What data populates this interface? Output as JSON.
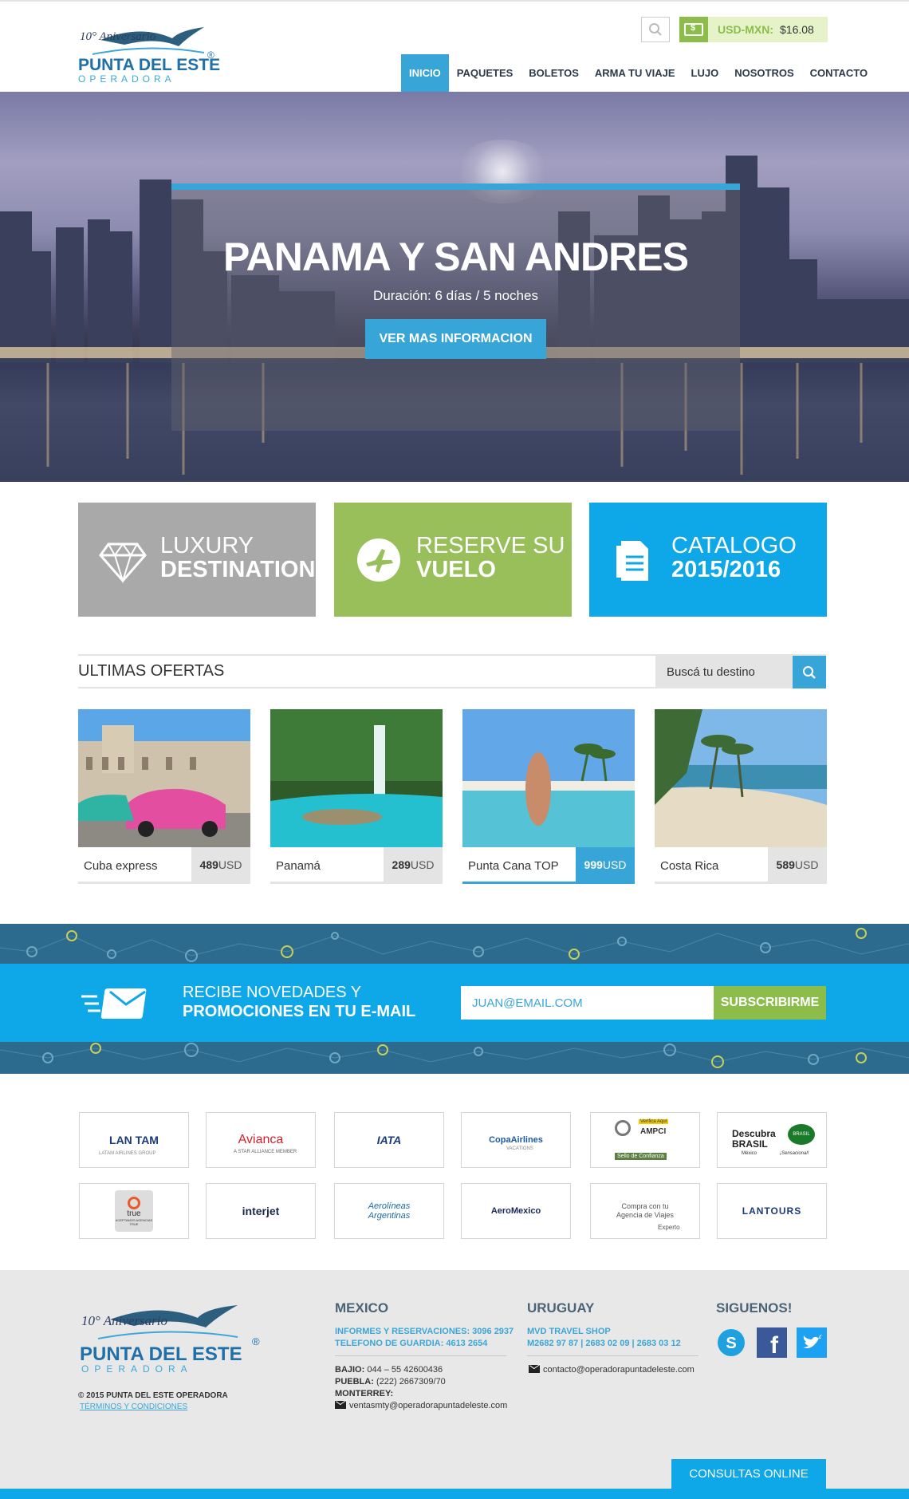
{
  "header": {
    "logo": {
      "anniversary": "10° Aniversario",
      "name": "PUNTA DEL ESTE",
      "subtitle": "OPERADORA",
      "registered": "®"
    },
    "currency": {
      "label": "USD-MXN:",
      "value": "$16.08"
    },
    "nav": [
      {
        "label": "INICIO",
        "active": true
      },
      {
        "label": "PAQUETES"
      },
      {
        "label": "BOLETOS"
      },
      {
        "label": "ARMA TU VIAJE"
      },
      {
        "label": "LUJO"
      },
      {
        "label": "NOSOTROS"
      },
      {
        "label": "CONTACTO"
      }
    ]
  },
  "hero": {
    "title": "PANAMA Y SAN ANDRES",
    "subtitle": "Duración: 6 días / 5 noches",
    "button": "VER MAS INFORMACION"
  },
  "tiles": [
    {
      "line1": "LUXURY",
      "line2": "DESTINATION",
      "color": "#a9a9a9",
      "icon": "diamond-icon"
    },
    {
      "line1": "RESERVE SU",
      "line2": "VUELO",
      "color": "#98bf5a",
      "icon": "airplane-icon"
    },
    {
      "line1": "CATALOGO",
      "line2": "2015/2016",
      "color": "#0ea8e8",
      "icon": "document-icon"
    }
  ],
  "offers": {
    "title": "ULTIMAS OFERTAS",
    "search_placeholder": "Buscá tu destino",
    "cards": [
      {
        "name": "Cuba express",
        "price": "489",
        "currency": "USD"
      },
      {
        "name": "Panamá",
        "price": "289",
        "currency": "USD"
      },
      {
        "name": "Punta Cana TOP",
        "price": "999",
        "currency": "USD",
        "highlight": true
      },
      {
        "name": "Costa Rica",
        "price": "589",
        "currency": "USD"
      }
    ]
  },
  "newsletter": {
    "line1": "RECIBE NOVEDADES Y",
    "line2": "PROMOCIONES EN TU E-MAIL",
    "placeholder": "JUAN@EMAIL.COM",
    "button": "SUBSCRIBIRME"
  },
  "partners": [
    "LAN TAM",
    "Avianca",
    "IATA",
    "CopaAirlines",
    "AMPCI",
    "Descubra BRASIL",
    "true",
    "interjet",
    "Aerolíneas Argentinas",
    "AeroMexico",
    "Compra con tu Agencia de Viajes",
    "LANTOURS"
  ],
  "partner_extras": {
    "lan_small": "LATAM AIRLINES GROUP",
    "avianca_small": "A STAR ALLIANCE MEMBER",
    "copa_small": "VACATIONS",
    "ampci_top": "Verifica Aquí",
    "ampci_small": "Sello de Confianza",
    "brasil_small": "¡Sensacional!",
    "brasil_mx": "México",
    "brasil_badge": "BRASIL",
    "true_small": "ACEPTAMOS AGENCIAS TRUE",
    "compra_small": "Experto"
  },
  "footer": {
    "copyright": "© 2015 PUNTA DEL ESTE OPERADORA",
    "terms": "TÉRMINOS Y CONDICIONES",
    "mexico": {
      "title": "MEXICO",
      "info1": "INFORMES Y RESERVACIONES: 3096 2937",
      "info2": "TELEFONO DE GUARDIA: 4613 2654",
      "bajio_label": "BAJIO:",
      "bajio": "044 – 55 42600436",
      "puebla_label": "PUEBLA:",
      "puebla": "(222) 2667309/70",
      "monterrey_label": "MONTERREY:",
      "email": "ventasmty@operadorapuntadeleste.com"
    },
    "uruguay": {
      "title": "URUGUAY",
      "info1": "MVD TRAVEL SHOP",
      "info2": "M2682 97 87 | 2683 02 09 | 2683 03 12",
      "email": "contacto@operadorapuntadeleste.com"
    },
    "social": {
      "title": "SIGUENOS!"
    },
    "consultas": "CONSULTAS ONLINE"
  }
}
